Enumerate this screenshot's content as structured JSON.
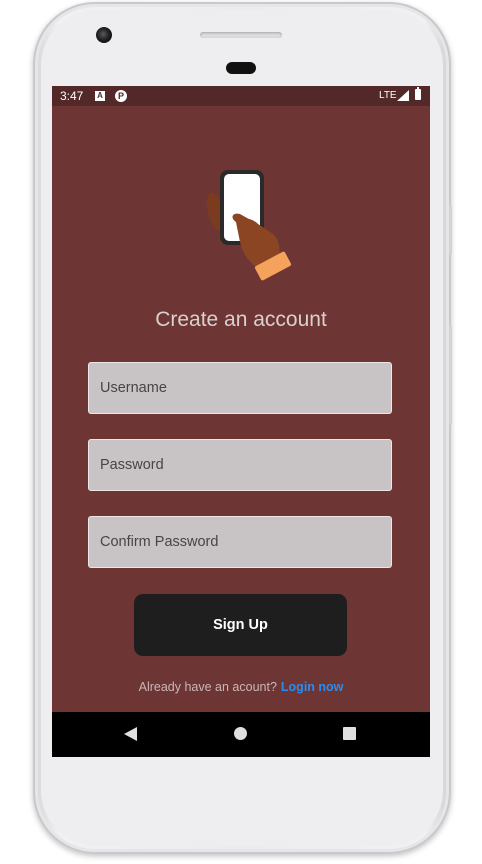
{
  "status_bar": {
    "time": "3:47",
    "notif_a": "A",
    "notif_p": "P",
    "network": "LTE"
  },
  "screen": {
    "background_color": "#6e3535",
    "illustration_icon": "hand-holding-phone-icon",
    "title": "Create an account"
  },
  "form": {
    "username_placeholder": "Username",
    "password_placeholder": "Password",
    "confirm_password_placeholder": "Confirm Password",
    "signup_label": "Sign Up"
  },
  "footer": {
    "prompt": "Already have an acount?",
    "login_label": "Login now",
    "link_color": "#2b8cf0"
  },
  "nav_bar": {
    "back_icon": "back-triangle-icon",
    "home_icon": "home-circle-icon",
    "recents_icon": "recents-square-icon"
  }
}
